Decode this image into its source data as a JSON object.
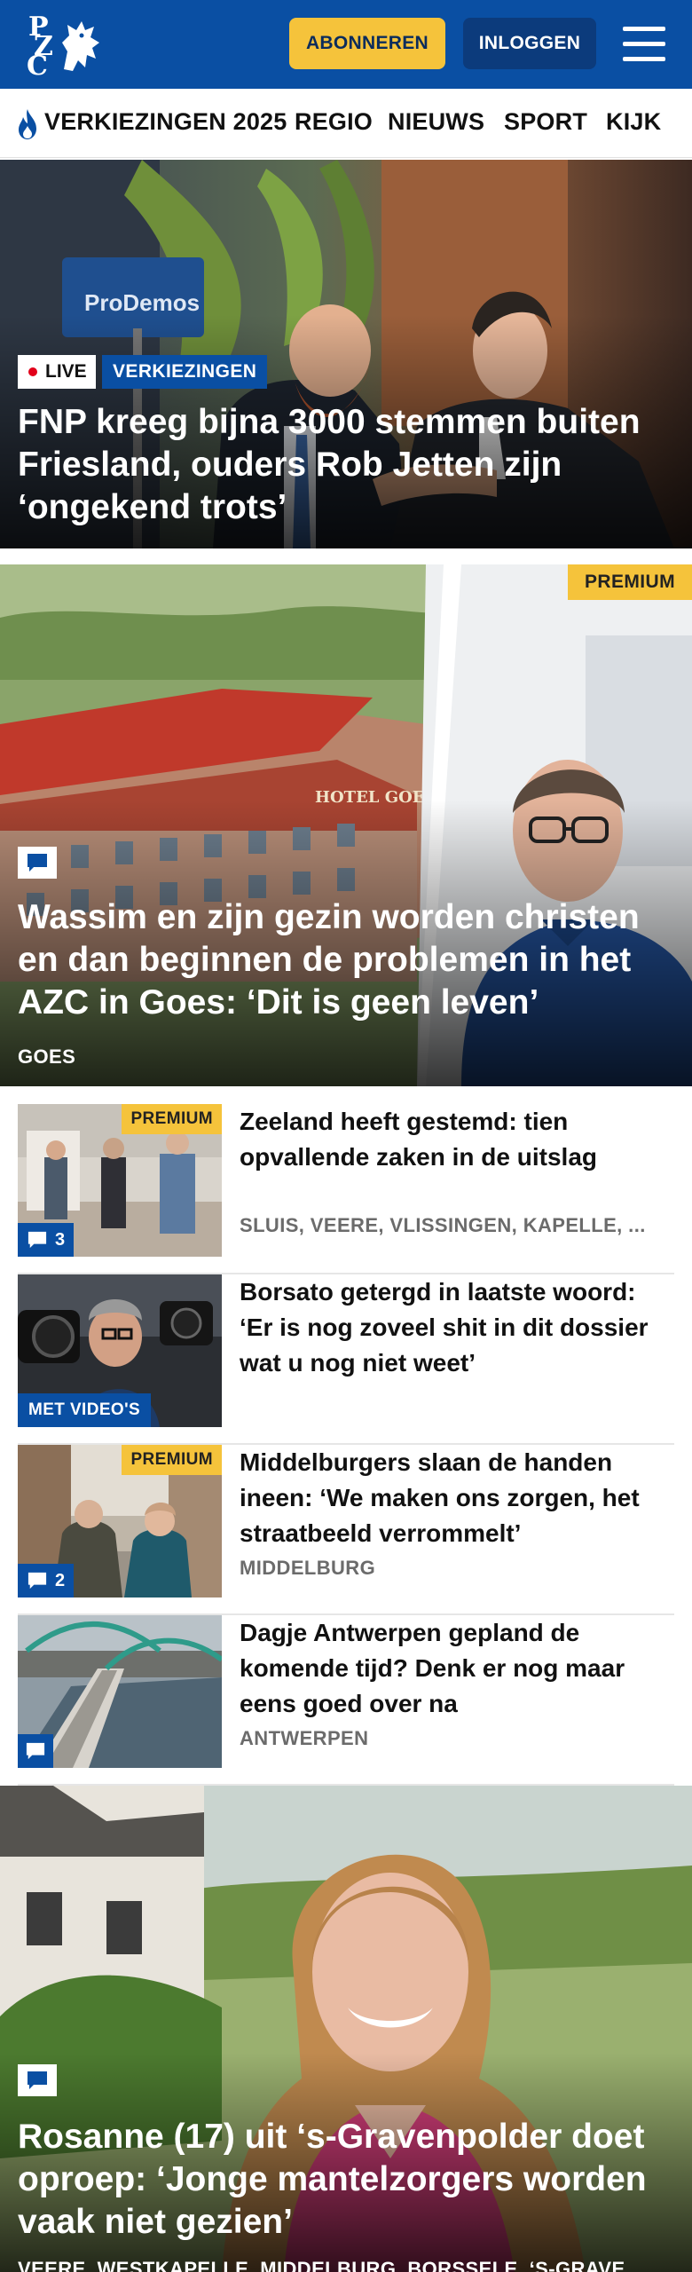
{
  "header": {
    "logo": "PZC",
    "subscribe_label": "ABONNEREN",
    "login_label": "INLOGGEN",
    "menu_icon": "hamburger-icon"
  },
  "nav": {
    "items": [
      {
        "label": "VERKIEZINGEN 2025",
        "icon": "flame-icon"
      },
      {
        "label": "REGIO"
      },
      {
        "label": "NIEUWS"
      },
      {
        "label": "SPORT"
      },
      {
        "label": "KIJK"
      }
    ]
  },
  "hero1": {
    "live_label": "LIVE",
    "category": "VERKIEZINGEN",
    "title": "FNP kreeg bijna 3000 stemmen buiten Friesland, ouders Rob Jetten zijn ‘ongekend trots’",
    "sign_text": "ProDemos"
  },
  "hero2": {
    "premium_label": "PREMIUM",
    "comment_icon": "comment-icon",
    "title": "Wassim en zijn gezin worden christen en dan beginnen de problemen in het AZC in Goes: ‘Dit is geen leven’",
    "place": "GOES",
    "building_sign": "HOTEL GOES"
  },
  "list": [
    {
      "title": "Zeeland heeft gestemd: tien opvallende zaken in de uitslag",
      "place": "SLUIS, VEERE, VLISSINGEN, KAPELLE, ...",
      "premium_label": "PREMIUM",
      "comments": "3"
    },
    {
      "title": "Borsato getergd in laatste woord: ‘Er is nog zoveel shit in dit dossier wat u nog niet weet’",
      "video_label": "MET VIDEO'S"
    },
    {
      "title": "Middelburgers slaan de handen ineen: ‘We maken ons zorgen, het straatbeeld verrommelt’",
      "place": "MIDDELBURG",
      "premium_label": "PREMIUM",
      "comments": "2"
    },
    {
      "title": "Dagje Antwerpen gepland de komende tijd? Denk er nog maar eens goed over na",
      "place": "ANTWERPEN"
    }
  ],
  "hero3": {
    "comment_icon": "comment-icon",
    "title": "Rosanne (17) uit ‘s-Gravenpolder doet oproep: ‘Jonge mantelzorgers worden vaak niet gezien’",
    "place": "VEERE, WESTKAPELLE, MIDDELBURG, BORSSELE, ‘S-GRAVE..."
  },
  "colors": {
    "brand_blue": "#0a4fa3",
    "premium_yellow": "#f5c33b",
    "live_red": "#e2001a"
  }
}
